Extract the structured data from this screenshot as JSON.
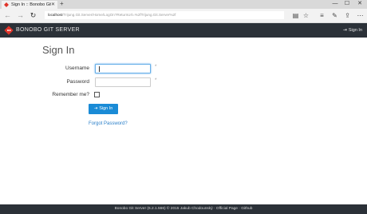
{
  "browser": {
    "tab_title": "Sign In :: Bonobo Git Se",
    "tab_close": "✕",
    "new_tab": "+",
    "url_host": "localhost",
    "url_path": "/Trijung.Git.Server/Home/LogOn?ReturnUrl=%2fTrijung.Git.Server%2f",
    "window_controls": {
      "minimize": "—",
      "maximize": "☐",
      "close": "✕"
    }
  },
  "header": {
    "brand": "BONOBO GIT SERVER",
    "sign_in_label": "Sign In",
    "accent_color": "#e0342a"
  },
  "form": {
    "title": "Sign In",
    "username_label": "Username",
    "username_value": "",
    "password_label": "Password",
    "password_value": "",
    "required_mark": "*",
    "remember_label": "Remember me?",
    "remember_checked": false,
    "submit_label": "Sign In",
    "forgot_label": "Forgot Password?"
  },
  "footer": {
    "text": "Bonobo Git Server (6.2.1.566) © 2015 Jakub Chodounský · Official Page · Github"
  }
}
